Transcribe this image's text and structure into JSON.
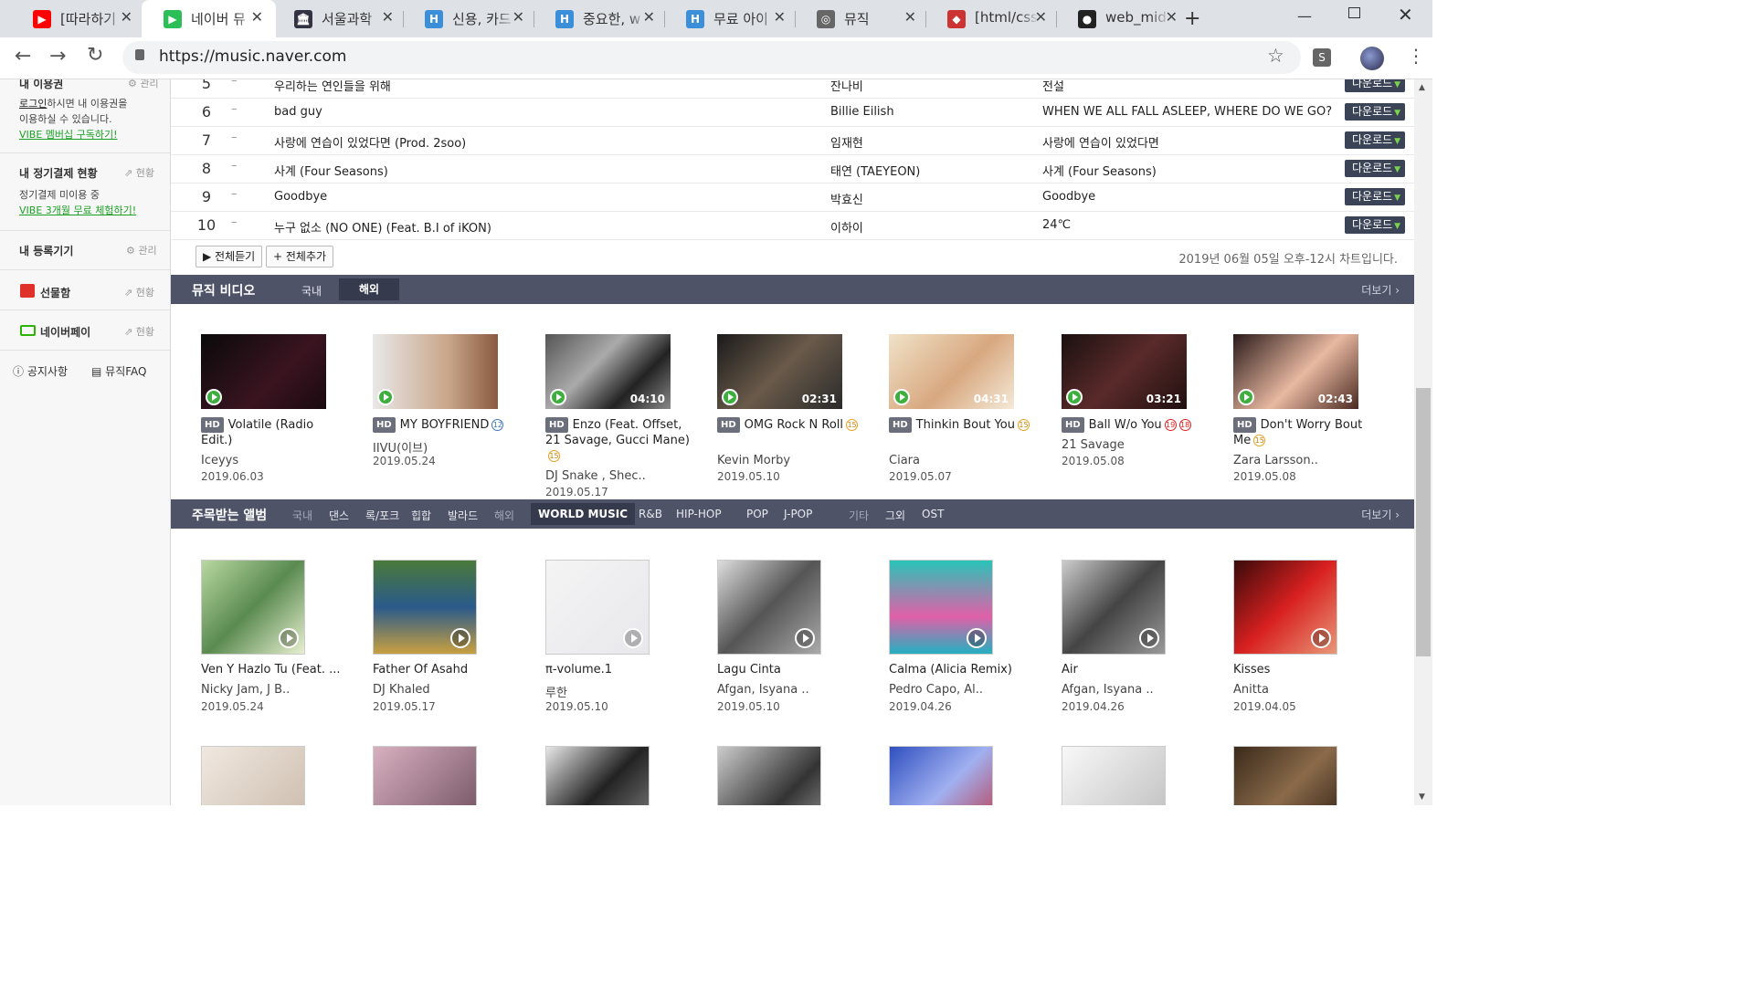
{
  "browser": {
    "tabs": [
      {
        "title": "[따라하기",
        "fav": "▶",
        "color": "#ff0000"
      },
      {
        "title": "네이버 뮤",
        "fav": "▶",
        "color": "#2dbf57",
        "active": true
      },
      {
        "title": "서울과학",
        "fav": "🏛",
        "color": "#334"
      },
      {
        "title": "신용, 카드",
        "fav": "H",
        "color": "#3a8fd8"
      },
      {
        "title": "중요한, w",
        "fav": "H",
        "color": "#3a8fd8"
      },
      {
        "title": "무료 아이",
        "fav": "H",
        "color": "#3a8fd8"
      },
      {
        "title": "뮤직",
        "fav": "◎",
        "color": "#666"
      },
      {
        "title": "[html/css]",
        "fav": "◆",
        "color": "#c33"
      },
      {
        "title": "web_mid",
        "fav": "●",
        "color": "#222"
      }
    ],
    "url": "https://music.naver.com",
    "new_tab": "+",
    "ext_label": "S"
  },
  "sidebar": {
    "voucher_title": "내 이용권",
    "manage": "관리",
    "login_link": "로그인",
    "login_text": "하시면 내 이용권을",
    "login_text2": "이용하실 수 있습니다.",
    "vibe_link": "VIBE 멤버십 구독하기!",
    "pay_title": "내 정기결제 현황",
    "status": "현황",
    "pay_text": "정기결제 미이용 중",
    "trial_link": "VIBE 3개월 무료 체험하기!",
    "device_title": "내 등록기기",
    "gift": "선물함",
    "npay": "네이버페이",
    "notice": "공지사항",
    "faq": "뮤직FAQ"
  },
  "chart": {
    "rows": [
      {
        "rank": "5",
        "change": "–",
        "title": "우리하는 연인들을 위해",
        "artist": "잔나비",
        "album": "전설"
      },
      {
        "rank": "6",
        "change": "–",
        "title": "bad guy",
        "artist": "Billie Eilish",
        "album": "WHEN WE ALL FALL ASLEEP, WHERE DO WE GO?"
      },
      {
        "rank": "7",
        "change": "–",
        "title": "사랑에 연습이 있었다면 (Prod. 2soo)",
        "artist": "임재현",
        "album": "사랑에 연습이 있었다면"
      },
      {
        "rank": "8",
        "change": "–",
        "title": "사계 (Four Seasons)",
        "artist": "태연 (TAEYEON)",
        "album": "사계 (Four Seasons)"
      },
      {
        "rank": "9",
        "change": "–",
        "title": "Goodbye",
        "artist": "박효신",
        "album": "Goodbye"
      },
      {
        "rank": "10",
        "change": "–",
        "title": "누구 없소 (NO ONE) (Feat. B.I of iKON)",
        "artist": "이하이",
        "album": "24℃"
      }
    ],
    "download": "다운로드",
    "play_all": "▶ 전체듣기",
    "add_all": "+ 전체추가",
    "chart_time": "2019년 06월 05일 오후-12시 차트입니다."
  },
  "mv": {
    "title": "뮤직 비디오",
    "tab_domestic": "국내",
    "tab_foreign": "해외",
    "more": "더보기 ›",
    "hd": "HD",
    "items": [
      {
        "title": "Volatile (Radio Edit.)",
        "age": "",
        "artist": "Iceyys",
        "date": "2019.06.03",
        "dur": "",
        "bg": "linear-gradient(135deg,#0a0a0a,#3a1420 60%,#1a0a10)"
      },
      {
        "title": "MY BOYFRIEND",
        "age": "12",
        "artist": "IIVU(이브)",
        "date": "2019.05.24",
        "dur": "",
        "bg": "linear-gradient(90deg,#e8e8e8,#c9a68a 60%,#8a5a40)"
      },
      {
        "title": "Enzo (Feat. Offset, 21 Savage, Gucci Mane)",
        "age": "15",
        "artist": "DJ Snake , Shec..",
        "date": "2019.05.17",
        "dur": "04:10",
        "bg": "linear-gradient(135deg,#555,#aaa 40%,#222 70%,#888)"
      },
      {
        "title": "OMG Rock N Roll",
        "age": "15",
        "artist": "Kevin Morby",
        "date": "2019.05.10",
        "dur": "02:31",
        "bg": "linear-gradient(135deg,#1a1a1a,#6a5a4a 50%,#2a2a2a)"
      },
      {
        "title": "Thinkin Bout You",
        "age": "15",
        "artist": "Ciara",
        "date": "2019.05.07",
        "dur": "04:31",
        "bg": "linear-gradient(135deg,#f0e2c8,#d8a880 55%,#f4ead8)"
      },
      {
        "title": "Ball W/o You",
        "age": "19",
        "artist": "21 Savage",
        "date": "2019.05.08",
        "dur": "03:21",
        "bg": "linear-gradient(135deg,#1a1010,#5a2a2a 50%,#201010)"
      },
      {
        "title": "Don't Worry Bout Me",
        "age": "15",
        "artist": "Zara Larsson..",
        "date": "2019.05.08",
        "dur": "02:43",
        "bg": "linear-gradient(135deg,#2a1a1a,#e8b8a0 55%,#4a2a22)"
      }
    ]
  },
  "albums": {
    "title": "주목받는 앨범",
    "genres_dom": [
      "국내",
      "댄스",
      "록/포크",
      "힙합",
      "발라드"
    ],
    "genres_for": [
      "해외",
      "WORLD MUSIC",
      "R&B",
      "HIP-HOP",
      "POP",
      "J-POP"
    ],
    "genres_etc": [
      "기타",
      "그외",
      "OST"
    ],
    "more": "더보기 ›",
    "items": [
      {
        "title": "Ven Y Hazlo Tu (Feat. ...",
        "artist": "Nicky Jam, J B..",
        "date": "2019.05.24",
        "bg": "linear-gradient(135deg,#b8d8a0,#5a8a50 50%,#e8f0d0)"
      },
      {
        "title": "Father Of Asahd",
        "artist": "DJ Khaled",
        "date": "2019.05.17",
        "bg": "linear-gradient(180deg,#4a7a3a,#2a5a8a 50%,#c8a040)"
      },
      {
        "title": "π-volume.1",
        "artist": "루한",
        "date": "2019.05.10",
        "bg": "linear-gradient(135deg,#f4f4f4,#e8e8ec)"
      },
      {
        "title": "Lagu Cinta",
        "artist": "Afgan, Isyana ..",
        "date": "2019.05.10",
        "bg": "linear-gradient(135deg,#ddd,#555 50%,#aaa)"
      },
      {
        "title": "Calma (Alicia Remix)",
        "artist": "Pedro Capo, Al..",
        "date": "2019.04.26",
        "bg": "linear-gradient(180deg,#29c4b8,#e060a8 60%,#24b0c0)"
      },
      {
        "title": "Air",
        "artist": "Afgan, Isyana ..",
        "date": "2019.04.26",
        "bg": "linear-gradient(135deg,#ccc,#444 50%,#999)"
      },
      {
        "title": "Kisses",
        "artist": "Anitta",
        "date": "2019.04.05",
        "bg": "linear-gradient(135deg,#3a0a0a,#d82020 50%,#e89878)"
      }
    ],
    "row2": [
      {
        "bg": "linear-gradient(135deg,#f0e8e0,#c8b8a8)"
      },
      {
        "bg": "linear-gradient(135deg,#d8b0c0,#6a4a5a)"
      },
      {
        "bg": "linear-gradient(135deg,#e8e8e8,#222 50%,#888)"
      },
      {
        "bg": "linear-gradient(135deg,#ccc,#333 60%,#999)"
      },
      {
        "bg": "linear-gradient(135deg,#3050c0,#a0b0f0 50%,#c03040)"
      },
      {
        "bg": "linear-gradient(135deg,#f8f8f8,#bbb)"
      },
      {
        "bg": "linear-gradient(135deg,#3a2a1a,#8a6a4a 50%,#2a1a10)"
      }
    ]
  }
}
